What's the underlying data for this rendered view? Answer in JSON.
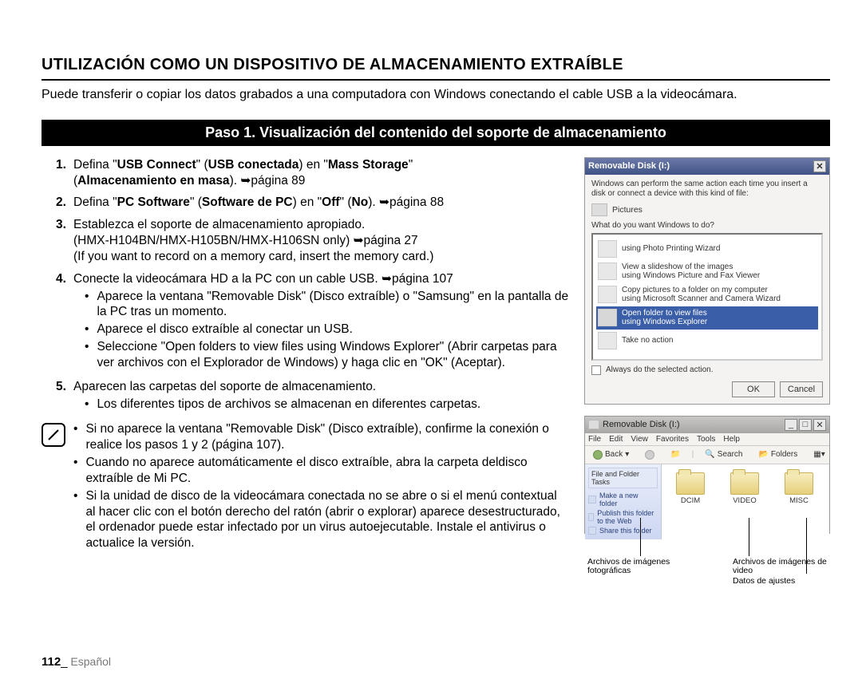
{
  "title": "UTILIZACIÓN COMO UN DISPOSITIVO DE ALMACENAMIENTO EXTRAÍBLE",
  "intro": "Puede transferir o copiar los datos grabados a una computadora con Windows conectando el cable USB a la videocámara.",
  "stepbar": "Paso 1. Visualización del contenido del soporte de almacenamiento",
  "steps": {
    "s1": {
      "num": "1.",
      "a": "Defina \"",
      "b1": "USB Connect",
      "c": "\" (",
      "b2": "USB conectada",
      "d": ") en \"",
      "b3": "Mass Storage",
      "e": "\"",
      "line2a": "(",
      "line2b": "Almacenamiento en masa",
      "line2c": "). ",
      "pg": "➥página 89"
    },
    "s2": {
      "num": "2.",
      "a": "Defina \"",
      "b1": "PC Software",
      "c": "\" (",
      "b2": "Software de PC",
      "d": ") en \"",
      "b3": "Off",
      "e": "\" (",
      "b4": "No",
      "f": "). ",
      "pg": "➥página 88"
    },
    "s3": {
      "num": "3.",
      "l1": "Establezca el soporte de almacenamiento apropiado.",
      "l2a": "(HMX-H104BN/HMX-H105BN/HMX-H106SN only) ",
      "l2pg": "➥página 27",
      "l3": "(If you want to record on a memory card, insert the memory card.)"
    },
    "s4": {
      "num": "4.",
      "l1a": "Conecte la videocámara HD a la PC con un cable USB. ",
      "l1pg": "➥página 107",
      "b1": "Aparece la ventana \"Removable Disk\" (Disco extraíble) o \"Samsung\" en la pantalla de la PC tras un momento.",
      "b2": "Aparece el disco extraíble al conectar un USB.",
      "b3": "Seleccione \"Open folders to view files using Windows Explorer\" (Abrir carpetas para ver archivos con el Explorador de Windows) y haga clic en \"OK\" (Aceptar)."
    },
    "s5": {
      "num": "5.",
      "l1": "Aparecen las carpetas del soporte de almacenamiento.",
      "b1": "Los diferentes tipos de archivos se almacenan en diferentes carpetas."
    }
  },
  "notes": {
    "n1": "Si no aparece la ventana \"Removable Disk\" (Disco extraíble), confirme la conexión o realice los pasos 1 y 2 (página 107).",
    "n2": "Cuando no aparece automáticamente el disco extraíble, abra la carpeta deldisco extraíble de Mi PC.",
    "n3": "Si la unidad de disco de la videocámara conectada no se abre o si el menú contextual al hacer clic con el botón derecho del ratón (abrir o explorar) aparece desestructurado, el ordenador puede estar infectado por un virus autoejecutable. Instale el antivirus o actualice la versión."
  },
  "dialog": {
    "title": "Removable Disk (I:)",
    "desc": "Windows can perform the same action each time you insert a disk or connect a device with this kind of file:",
    "kind": "Pictures",
    "prompt": "What do you want Windows to do?",
    "opts": {
      "o1a": "using Photo Printing Wizard",
      "o2a": "View a slideshow of the images",
      "o2b": "using Windows Picture and Fax Viewer",
      "o3a": "Copy pictures to a folder on my computer",
      "o3b": "using Microsoft Scanner and Camera Wizard",
      "o4a": "Open folder to view files",
      "o4b": "using Windows Explorer",
      "o5a": "Take no action"
    },
    "always": "Always do the selected action.",
    "ok": "OK",
    "cancel": "Cancel"
  },
  "explorer": {
    "title": "Removable Disk (I:)",
    "menus": {
      "m1": "File",
      "m2": "Edit",
      "m3": "View",
      "m4": "Favorites",
      "m5": "Tools",
      "m6": "Help"
    },
    "back": "Back",
    "search": "Search",
    "foldersbtn": "Folders",
    "panel_title": "File and Folder Tasks",
    "sp1": "Make a new folder",
    "sp2": "Publish this folder to the Web",
    "sp3": "Share this folder",
    "f1": "DCIM",
    "f2": "VIDEO",
    "f3": "MISC"
  },
  "captions": {
    "c1": "Archivos de imágenes fotográficas",
    "c2": "Archivos de imágenes de video",
    "c3": "Datos de ajustes"
  },
  "footer": {
    "page": "112",
    "sep": "_",
    "lang": " Español"
  }
}
